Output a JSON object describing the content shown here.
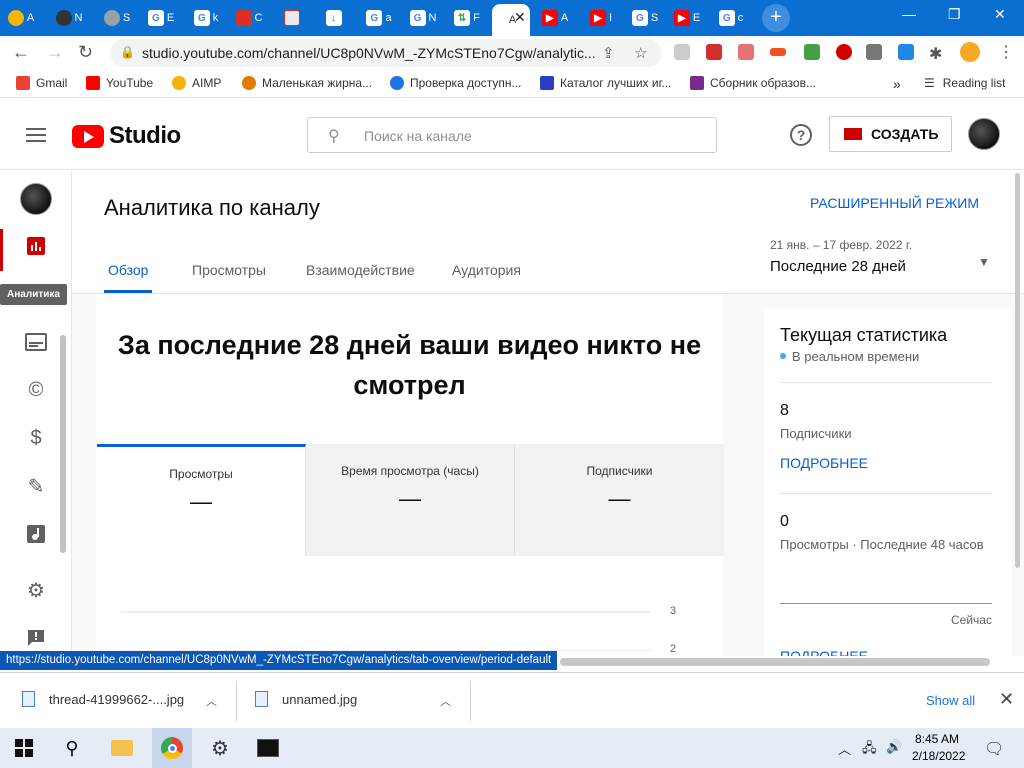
{
  "browser": {
    "tabs": [
      {
        "label": "A",
        "icon": "aimp-icon",
        "color": "#f5b400"
      },
      {
        "label": "N",
        "icon": "github-icon",
        "color": "#333333"
      },
      {
        "label": "S",
        "icon": "settings-icon",
        "color": "#888888"
      },
      {
        "label": "E",
        "icon": "google-icon",
        "color": "#4285f4"
      },
      {
        "label": "k",
        "icon": "google-icon",
        "color": "#4285f4"
      },
      {
        "label": "C",
        "icon": "download-red-icon",
        "color": "#d93025"
      },
      {
        "label": "",
        "icon": "image-icon",
        "color": "#888888"
      },
      {
        "label": "",
        "icon": "download-icon",
        "color": "#1a73e8"
      },
      {
        "label": "a",
        "icon": "google-icon",
        "color": "#4285f4"
      },
      {
        "label": "N",
        "icon": "google-icon",
        "color": "#4285f4"
      },
      {
        "label": "F",
        "icon": "updown-icon",
        "color": "#34a853"
      },
      {
        "label": "A",
        "icon": "studio-icon",
        "color": "#ff0000"
      },
      {
        "label": "A",
        "icon": "youtube-icon",
        "color": "#ff0000"
      },
      {
        "label": "I",
        "icon": "youtube-icon",
        "color": "#ff0000"
      },
      {
        "label": "S",
        "icon": "google-icon",
        "color": "#4285f4"
      },
      {
        "label": "E",
        "icon": "youtube-icon",
        "color": "#ff0000"
      },
      {
        "label": "c",
        "icon": "google-icon",
        "color": "#4285f4"
      }
    ],
    "url": "studio.youtube.com/channel/UC8p0NVwM_-ZYMcSTEno7Cgw/analytic..."
  },
  "bookmarks": [
    {
      "label": "Gmail",
      "color": "#ea4335"
    },
    {
      "label": "YouTube",
      "color": "#ff0000"
    },
    {
      "label": "AIMP",
      "color": "#f5b400"
    },
    {
      "label": "Маленькая жирна...",
      "color": "#e07b00"
    },
    {
      "label": "Проверка доступн...",
      "color": "#1a73e8"
    },
    {
      "label": "Каталог лучших иг...",
      "color": "#2a3fbf"
    },
    {
      "label": "Сборник образов...",
      "color": "#7a2a8a"
    }
  ],
  "reading_list": "Reading list",
  "studio": {
    "logo_text": "Studio",
    "search_placeholder": "Поиск на канале",
    "create_label": "СОЗДАТЬ"
  },
  "nav": {
    "tooltip": "Аналитика"
  },
  "main": {
    "title": "Аналитика по каналу",
    "advanced_mode": "РАСШИРЕННЫЙ РЕЖИМ",
    "tabs": [
      "Обзор",
      "Просмотры",
      "Взаимодействие",
      "Аудитория"
    ],
    "date_range": "21 янв. – 17 февр. 2022 г.",
    "period": "Последние 28 дней",
    "headline_line1": "За последние 28 дней ваши видео никто не",
    "headline_line2": "смотрел",
    "metrics": [
      {
        "label": "Просмотры",
        "value": "—"
      },
      {
        "label": "Время просмотра (часы)",
        "value": "—"
      },
      {
        "label": "Подписчики",
        "value": "—"
      }
    ],
    "chart_ticks": [
      "3",
      "2"
    ]
  },
  "realtime": {
    "title": "Текущая статистика",
    "subtitle": "В реальном времени",
    "subscribers_value": "8",
    "subscribers_label": "Подписчики",
    "more_label": "ПОДРОБНЕЕ",
    "views_value": "0",
    "views_label": "Просмотры · Последние 48 часов",
    "now_label": "Сейчас",
    "more_label_2": "ПОДРОБНЕЕ"
  },
  "status_url": "https://studio.youtube.com/channel/UC8p0NVwM_-ZYMcSTEno7Cgw/analytics/tab-overview/period-default",
  "downloads": {
    "items": [
      "thread-41999662-....jpg",
      "unnamed.jpg"
    ],
    "show_all": "Show all"
  },
  "taskbar": {
    "time": "8:45 AM",
    "date": "2/18/2022"
  }
}
